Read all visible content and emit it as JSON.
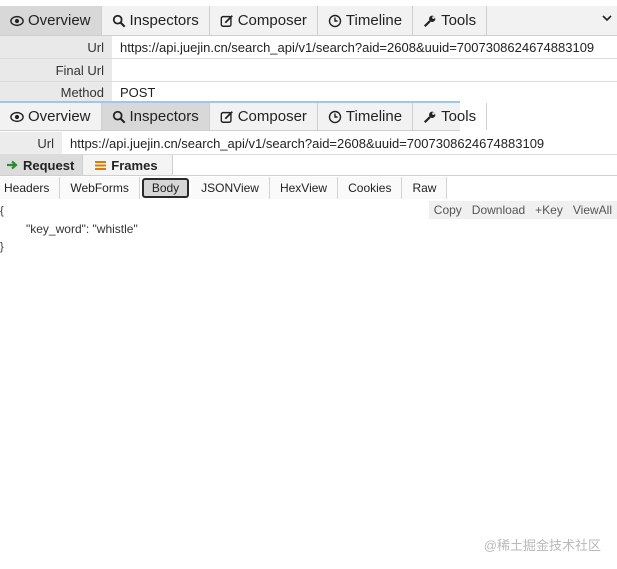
{
  "top_tabs": [
    {
      "label": "Overview",
      "icon": "eye-icon",
      "active": true
    },
    {
      "label": "Inspectors",
      "icon": "search-icon",
      "active": false
    },
    {
      "label": "Composer",
      "icon": "edit-icon",
      "active": false
    },
    {
      "label": "Timeline",
      "icon": "clock-icon",
      "active": false
    },
    {
      "label": "Tools",
      "icon": "wrench-icon",
      "active": false
    }
  ],
  "overview": {
    "url_label": "Url",
    "url_value": "https://api.juejin.cn/search_api/v1/search?aid=2608&uuid=7007308624674883109",
    "final_url_label": "Final Url",
    "final_url_value": "",
    "method_label": "Method",
    "method_value": "POST"
  },
  "inner_tabs": [
    {
      "label": "Overview",
      "icon": "eye-icon",
      "active": false
    },
    {
      "label": "Inspectors",
      "icon": "search-icon",
      "active": true
    },
    {
      "label": "Composer",
      "icon": "edit-icon",
      "active": false
    },
    {
      "label": "Timeline",
      "icon": "clock-icon",
      "active": false
    },
    {
      "label": "Tools",
      "icon": "wrench-icon",
      "active": false
    }
  ],
  "inspector": {
    "url_label": "Url",
    "url_value": "https://api.juejin.cn/search_api/v1/search?aid=2608&uuid=7007308624674883109",
    "request_tab": "Request",
    "frames_tab": "Frames",
    "subtabs": [
      "Headers",
      "WebForms",
      "Body",
      "JSONView",
      "HexView",
      "Cookies",
      "Raw"
    ],
    "active_subtab": "Body",
    "actions": [
      "Copy",
      "Download",
      "+Key",
      "ViewAll"
    ],
    "body_lines": [
      "{",
      "\"key_word\": \"whistle\"",
      "}"
    ]
  },
  "watermark": "@稀土掘金技术社区",
  "colors": {
    "request_arrow": "#2e8b2e",
    "frames_icon": "#e07b00",
    "active_tab_bg": "#d8d8d8",
    "blue_separator": "#9cc8ee"
  }
}
